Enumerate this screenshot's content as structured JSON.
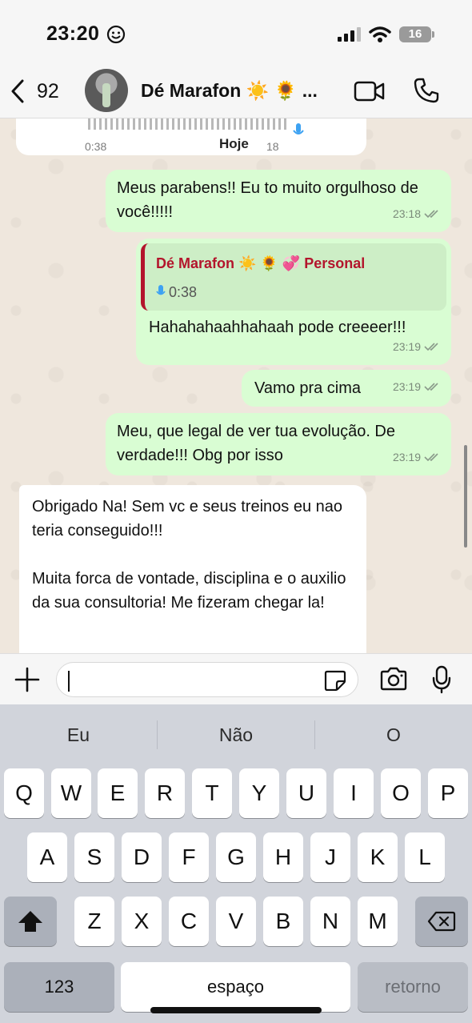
{
  "status": {
    "time": "23:20",
    "battery": "16"
  },
  "header": {
    "back_count": "92",
    "contact_name": "Dé Marafon ☀️ 🌻 ..."
  },
  "chat": {
    "prev_audio": {
      "duration": "0:38",
      "time_partial": "18"
    },
    "date_divider": "Hoje",
    "messages": [
      {
        "text": "Meus parabens!! Eu to muito orgulhoso de você!!!!!",
        "time": "23:18"
      },
      {
        "quote_author": "Dé Marafon ☀️ 🌻 💞  Personal",
        "quote_audio": "0:38",
        "text": "Hahahahaahhahaah pode creeeer!!!",
        "time": "23:19"
      },
      {
        "text": "Vamo pra cima",
        "time": "23:19"
      },
      {
        "text": "Meu, que legal de ver tua evolução. De verdade!!! Obg por isso",
        "time": "23:19"
      },
      {
        "p1": "Obrigado Na! Sem vc e seus treinos eu nao teria conseguido!!!",
        "p2": "Muita forca de vontade, disciplina e o auxilio da sua consultoria! Me fizeram chegar la!"
      }
    ]
  },
  "composer": {
    "input_value": ""
  },
  "keyboard": {
    "suggestions": [
      "Eu",
      "Não",
      "O"
    ],
    "row1": [
      "Q",
      "W",
      "E",
      "R",
      "T",
      "Y",
      "U",
      "I",
      "O",
      "P"
    ],
    "row2": [
      "A",
      "S",
      "D",
      "F",
      "G",
      "H",
      "J",
      "K",
      "L"
    ],
    "row3": [
      "Z",
      "X",
      "C",
      "V",
      "B",
      "N",
      "M"
    ],
    "numbers_label": "123",
    "space_label": "espaço",
    "return_label": "retorno"
  }
}
